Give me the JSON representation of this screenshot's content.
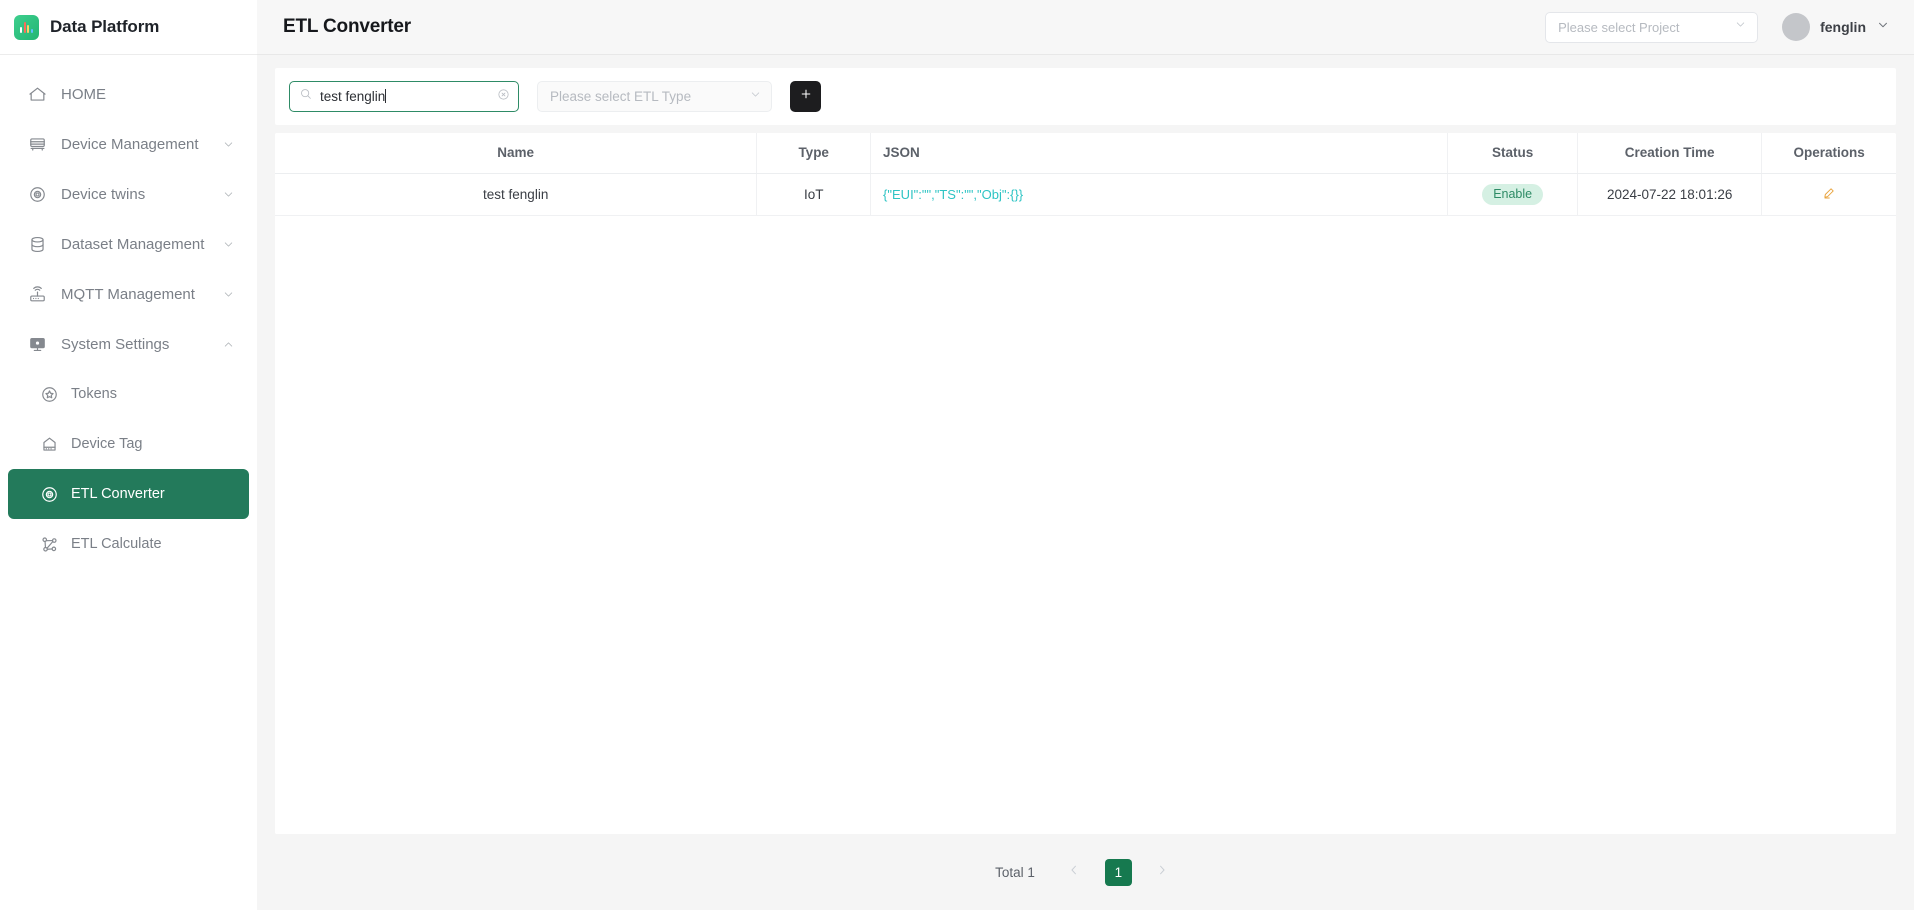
{
  "brand": {
    "title": "Data Platform",
    "logo_icon": "chart-logo-icon"
  },
  "sidebar": {
    "items": [
      {
        "label": "HOME",
        "icon": "home-icon",
        "expandable": false,
        "active": false,
        "sub": false
      },
      {
        "label": "Device Management",
        "icon": "server-icon",
        "expandable": true,
        "active": false,
        "sub": false
      },
      {
        "label": "Device twins",
        "icon": "target-icon",
        "expandable": true,
        "active": false,
        "sub": false
      },
      {
        "label": "Dataset Management",
        "icon": "database-icon",
        "expandable": true,
        "active": false,
        "sub": false
      },
      {
        "label": "MQTT Management",
        "icon": "router-icon",
        "expandable": true,
        "active": false,
        "sub": false
      },
      {
        "label": "System Settings",
        "icon": "monitor-icon",
        "expandable": true,
        "expanded": true,
        "active": false,
        "sub": false
      },
      {
        "label": "Tokens",
        "icon": "token-badge-icon",
        "expandable": false,
        "active": false,
        "sub": true
      },
      {
        "label": "Device Tag",
        "icon": "tag-device-icon",
        "expandable": false,
        "active": false,
        "sub": true
      },
      {
        "label": "ETL Converter",
        "icon": "target-icon",
        "expandable": false,
        "active": true,
        "sub": true
      },
      {
        "label": "ETL Calculate",
        "icon": "flow-nodes-icon",
        "expandable": false,
        "active": false,
        "sub": true
      }
    ]
  },
  "topbar": {
    "title": "ETL Converter",
    "project_select": {
      "placeholder": "Please select Project",
      "value": "",
      "icon": "chevron-down-icon"
    },
    "user": {
      "name": "fenglin",
      "avatar_icon": "avatar",
      "menu_icon": "chevron-down-icon"
    }
  },
  "toolbar": {
    "search": {
      "value": "test fenglin",
      "placeholder": "",
      "icon": "search-icon",
      "clear_icon": "clear-circle-icon"
    },
    "type_select": {
      "placeholder": "Please select ETL Type",
      "value": "",
      "icon": "chevron-down-icon"
    },
    "add_button": {
      "label": "+",
      "icon": "plus-icon"
    }
  },
  "table": {
    "columns": [
      "Name",
      "Type",
      "JSON",
      "Status",
      "Creation Time",
      "Operations"
    ],
    "rows": [
      {
        "name": "test fenglin",
        "type": "IoT",
        "json": "{\"EUI\":\"\",\"TS\":\"\",\"Obj\":{}}",
        "status": "Enable",
        "creation_time": "2024-07-22 18:01:26",
        "operation_icon": "edit-pencil-icon"
      }
    ]
  },
  "pagination": {
    "total_label": "Total 1",
    "prev_icon": "chevron-left-icon",
    "next_icon": "chevron-right-icon",
    "current_page": "1"
  },
  "colors": {
    "accent_green": "#237a5b",
    "pager_green": "#16794f",
    "badge_bg": "#d5f0e3",
    "badge_text": "#2e8b66",
    "json_teal": "#2ec4c4",
    "edit_orange": "#e8a33d",
    "page_bg": "#f5f5f5"
  }
}
